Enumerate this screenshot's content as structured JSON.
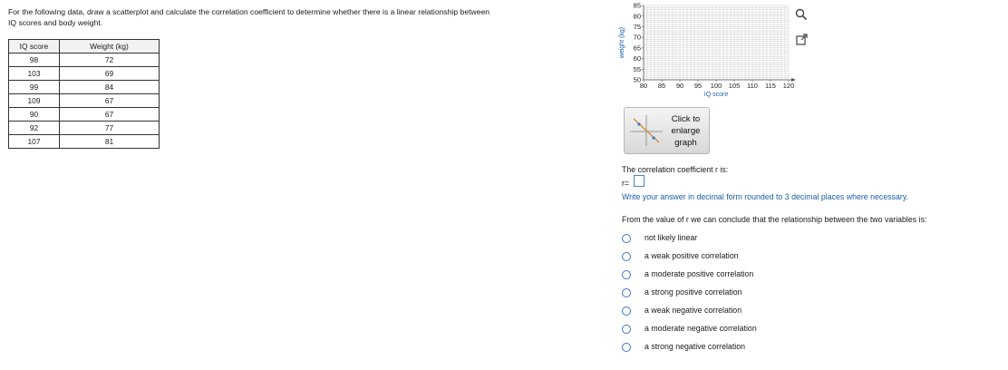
{
  "prompt": {
    "line1": "For the following data, draw a scatterplot and calculate the correlation coefficient to determine whether there is a linear  relationship between",
    "line2": "IQ scores and body weight."
  },
  "table": {
    "headers": [
      "IQ score",
      "Weight (kg)"
    ],
    "rows": [
      [
        "98",
        "72"
      ],
      [
        "103",
        "69"
      ],
      [
        "99",
        "84"
      ],
      [
        "109",
        "67"
      ],
      [
        "90",
        "67"
      ],
      [
        "92",
        "77"
      ],
      [
        "107",
        "81"
      ]
    ]
  },
  "chart_data": {
    "type": "scatter",
    "title": "",
    "xlabel": "IQ score",
    "ylabel": "weight (kg)",
    "xlim": [
      80,
      120
    ],
    "ylim": [
      50,
      85
    ],
    "x_ticks": [
      80,
      85,
      90,
      95,
      100,
      105,
      110,
      115,
      120
    ],
    "y_ticks": [
      50,
      55,
      60,
      65,
      70,
      75,
      80,
      85
    ],
    "grid": true,
    "series": [
      {
        "x": [],
        "y": []
      }
    ]
  },
  "controls": {
    "zoom_icon": "magnifier-icon",
    "popout_icon": "popout-icon",
    "enlarge_label_1": "Click to",
    "enlarge_label_2": "enlarge",
    "enlarge_label_3": "graph"
  },
  "answer": {
    "question": "The correlation coefficient r is:",
    "r_label": "r=",
    "r_value": "",
    "hint": "Write your answer in decimal form rounded to 3 decimal places where necessary."
  },
  "conclusion": {
    "question": "From the value of r we can conclude that the relationship between the two variables is:",
    "options": [
      "not likely linear",
      "a weak positive correlation",
      "a moderate positive correlation",
      "a strong positive correlation",
      "a weak negative correlation",
      "a moderate negative correlation",
      "a strong negative correlation"
    ]
  },
  "colors": {
    "accent": "#3b78c4",
    "hint": "#1a5fa8",
    "grid": "#cfcfcf"
  }
}
